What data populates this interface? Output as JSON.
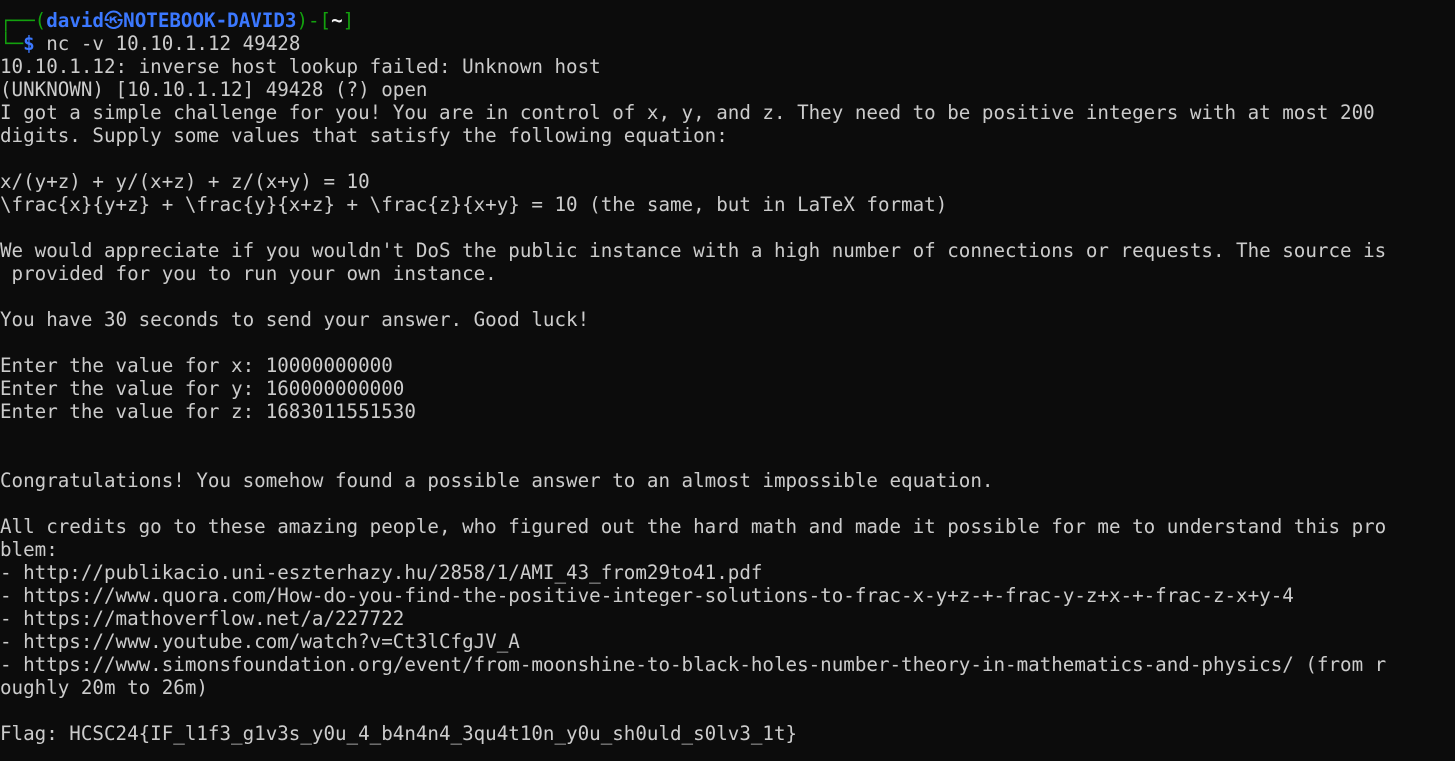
{
  "prompt": {
    "box_top_left": "┌──(",
    "user": "david",
    "separator": "㉿",
    "host": "NOTEBOOK-DAVID3",
    "after_host": ")-[",
    "cwd": "~",
    "close_bracket": "]",
    "box_bottom_left": "└─",
    "dollar": "$",
    "command": " nc -v 10.10.1.12 49428"
  },
  "output_lines": [
    "10.10.1.12: inverse host lookup failed: Unknown host",
    "(UNKNOWN) [10.10.1.12] 49428 (?) open",
    "I got a simple challenge for you! You are in control of x, y, and z. They need to be positive integers with at most 200",
    "digits. Supply some values that satisfy the following equation:",
    "",
    "x/(y+z) + y/(x+z) + z/(x+y) = 10",
    "\\frac{x}{y+z} + \\frac{y}{x+z} + \\frac{z}{x+y} = 10 (the same, but in LaTeX format)",
    "",
    "We would appreciate if you wouldn't DoS the public instance with a high number of connections or requests. The source is",
    " provided for you to run your own instance.",
    "",
    "You have 30 seconds to send your answer. Good luck!",
    "",
    "Enter the value for x: 10000000000",
    "Enter the value for y: 160000000000",
    "Enter the value for z: 1683011551530",
    "",
    "",
    "Congratulations! You somehow found a possible answer to an almost impossible equation.",
    "",
    "All credits go to these amazing people, who figured out the hard math and made it possible for me to understand this pro",
    "blem:",
    "- http://publikacio.uni-eszterhazy.hu/2858/1/AMI_43_from29to41.pdf",
    "- https://www.quora.com/How-do-you-find-the-positive-integer-solutions-to-frac-x-y+z-+-frac-y-z+x-+-frac-z-x+y-4",
    "- https://mathoverflow.net/a/227722",
    "- https://www.youtube.com/watch?v=Ct3lCfgJV_A",
    "- https://www.simonsfoundation.org/event/from-moonshine-to-black-holes-number-theory-in-mathematics-and-physics/ (from r",
    "oughly 20m to 26m)",
    "",
    "Flag: HCSC24{IF_l1f3_g1v3s_y0u_4_b4n4n4_3qu4t10n_y0u_sh0uld_s0lv3_1t}"
  ],
  "colors": {
    "background": "#0c0c0c",
    "foreground": "#cccccc",
    "prompt_green": "#13a10e",
    "prompt_blue": "#3b78ff"
  }
}
